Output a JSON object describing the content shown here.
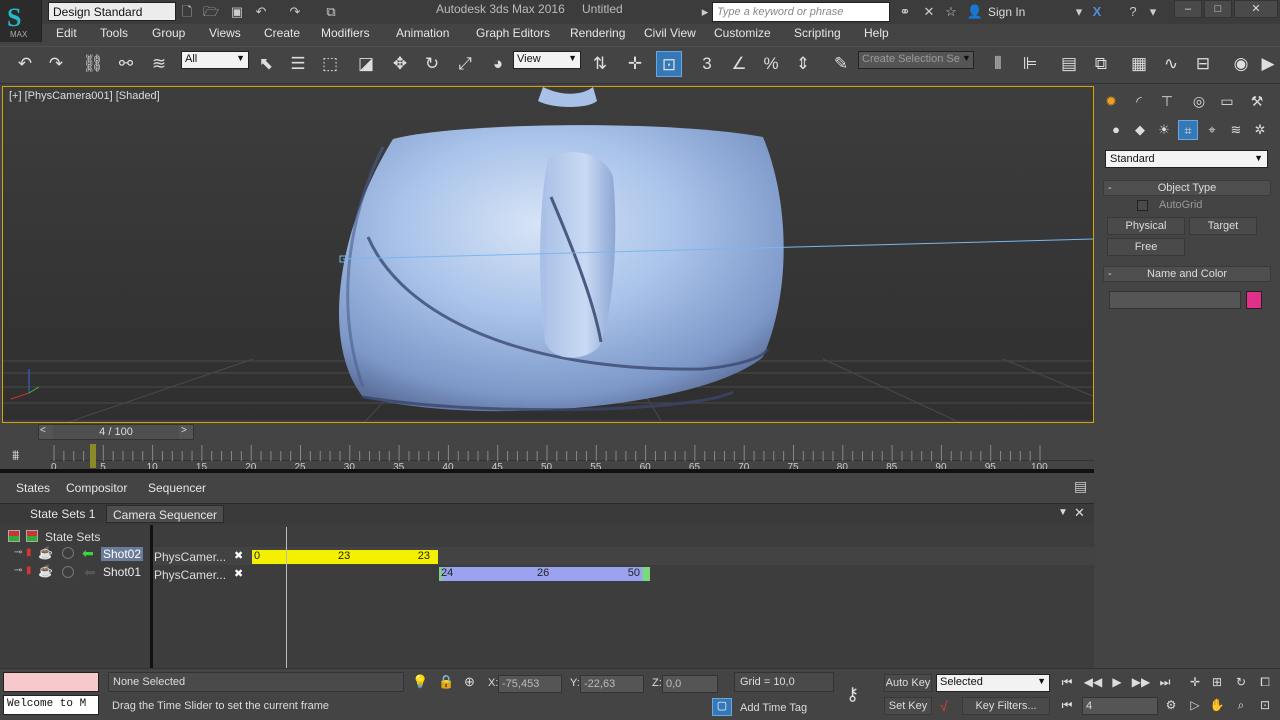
{
  "app": {
    "title": "Autodesk 3ds Max 2016",
    "document": "Untitled",
    "workspace": "Design Standard",
    "search_placeholder": "Type a keyword or phrase",
    "sign_in": "Sign In",
    "logo_text": "MAX"
  },
  "menu": [
    "Edit",
    "Tools",
    "Group",
    "Views",
    "Create",
    "Modifiers",
    "Animation",
    "Graph Editors",
    "Rendering",
    "Civil View",
    "Customize",
    "Scripting",
    "Help"
  ],
  "toolbar": {
    "filter": "All",
    "ref_coord": "View",
    "selection_set_placeholder": "Create Selection Se",
    "snap_label": "3"
  },
  "viewport": {
    "label": "[+] [PhysCamera001] [Shaded]"
  },
  "command_panel": {
    "category": "Standard",
    "object_type_title": "Object Type",
    "autogrid": "AutoGrid",
    "buttons": [
      "Physical",
      "Target",
      "Free"
    ],
    "name_color_title": "Name and Color",
    "swatch_color": "#e0308a"
  },
  "time_slider": {
    "frame_text": "4 / 100",
    "current_frame": 4,
    "range": [
      0,
      100
    ],
    "ticks": [
      "0",
      "5",
      "10",
      "15",
      "20",
      "25",
      "30",
      "35",
      "40",
      "45",
      "50",
      "55",
      "60",
      "65",
      "70",
      "75",
      "80",
      "85",
      "90",
      "95",
      "100"
    ]
  },
  "lower_tabs": [
    "States",
    "Compositor",
    "Sequencer"
  ],
  "seq_tabs": [
    "State Sets 1",
    "Camera Sequencer"
  ],
  "state_sets": {
    "root": "State Sets",
    "shots": [
      {
        "name": "Shot02",
        "camera": "PhysCamer...",
        "start": "0",
        "mid": "23",
        "end": "23",
        "color": "#f3f000"
      },
      {
        "name": "Shot01",
        "camera": "PhysCamer...",
        "start": "24",
        "mid": "26",
        "end": "50",
        "color": "#9aa2f0"
      }
    ]
  },
  "status": {
    "welcome": "Welcome to M",
    "selection": "None Selected",
    "prompt": "Drag the Time Slider to set the current frame",
    "x_label": "X:",
    "x": "-75,453",
    "y_label": "Y:",
    "y": "-22,63",
    "z_label": "Z:",
    "z": "0,0",
    "grid": "Grid = 10,0",
    "add_time_tag": "Add Time Tag",
    "auto_key": "Auto Key",
    "set_key": "Set Key",
    "key_mode": "Selected",
    "key_filters": "Key Filters...",
    "frame": "4"
  }
}
